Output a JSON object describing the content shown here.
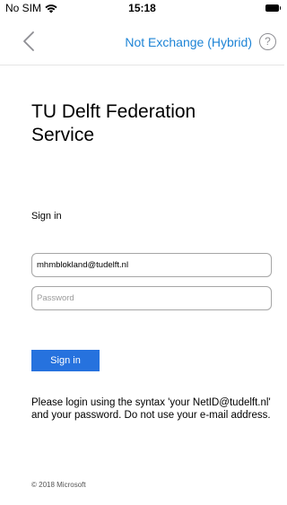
{
  "status_bar": {
    "carrier": "No SIM",
    "time": "15:18"
  },
  "nav": {
    "title": "Not Exchange (Hybrid)",
    "help_label": "?"
  },
  "page": {
    "heading": "TU Delft Federation Service",
    "signin_label": "Sign in",
    "username_value": "mhmblokland@tudelft.nl",
    "password_placeholder": "Password",
    "signin_button": "Sign in",
    "help_text": "Please login using the syntax 'your NetID@tudelft.nl' and your password. Do not use your e-mail address.",
    "footer": "© 2018 Microsoft"
  },
  "colors": {
    "accent": "#1e84d6",
    "button": "#2672de"
  }
}
